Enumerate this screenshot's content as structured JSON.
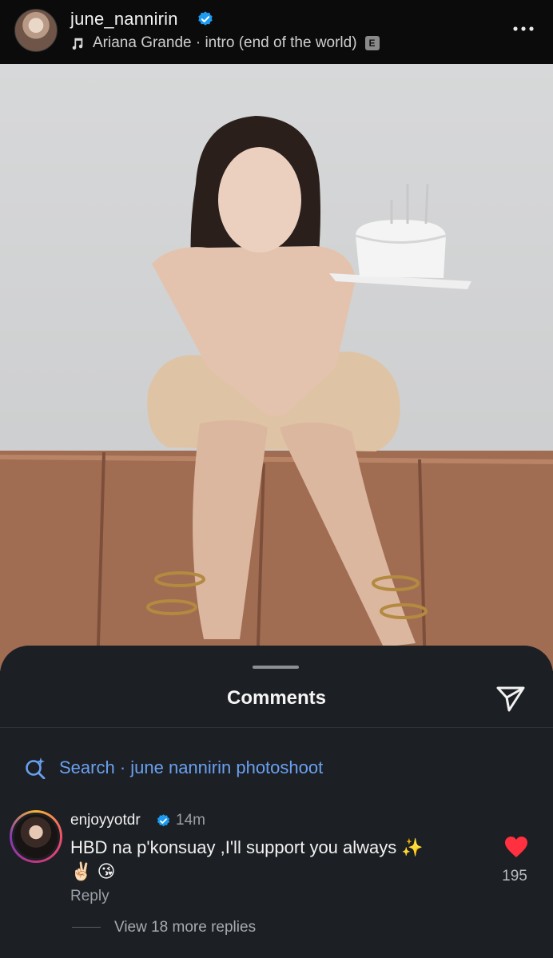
{
  "header": {
    "username": "june_nannirin",
    "verified_icon": "verified-badge-icon",
    "music_icon": "music-note-icon",
    "music_text": "Ariana Grande · intro (end of the world)",
    "explicit_label": "E",
    "more_icon": "more-options-icon"
  },
  "comments_sheet": {
    "title": "Comments",
    "share_icon": "send-icon",
    "search_icon": "sparkle-search-icon",
    "search_text": "Search · june nannirin photoshoot"
  },
  "comment": {
    "username": "enjoyyotdr",
    "time": "14m",
    "text": "HBD na p'konsuay ,I'll support you always ✨",
    "emoji_line": "✌🏻 😘",
    "reply_label": "Reply",
    "like_count": "195",
    "view_replies": "View 18 more replies"
  },
  "colors": {
    "sheet_bg": "#1c1f23",
    "accent_blue": "#6aa0f0",
    "heart_red": "#ff3040",
    "verified_blue": "#1d9bf0"
  }
}
